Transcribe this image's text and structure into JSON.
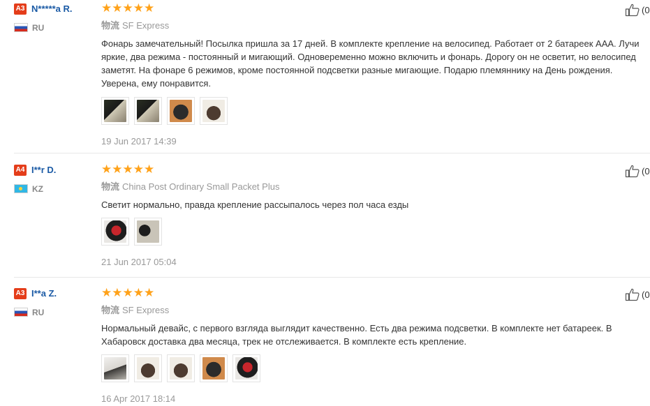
{
  "reviews": [
    {
      "level": "A3",
      "user": "N*****a R.",
      "country": "RU",
      "stars": "★★★★★",
      "logistics_label": "物流",
      "shipping": "SF Express",
      "text": "Фонарь замечательный! Посылка пришла за 17 дней. В комплекте крепление на велосипед. Работает от 2 батареек ААА. Лучи яркие, два режима - постоянный и мигающий. Одновеременно можно включить и фонарь. Дорогу он не осветит, но велосипед заметят. На фонаре 6 режимов, кроме постоянной подсветки разные мигающие. Подарю племяннику на День рождения. Уверена, ему понравится.",
      "date": "19 Jun 2017 14:39",
      "helpful": "(0",
      "photos": [
        "photo-dark-1",
        "photo-dark-2",
        "photo-bulb",
        "photo-ball"
      ]
    },
    {
      "level": "A4",
      "user": "I**r D.",
      "country": "KZ",
      "stars": "★★★★★",
      "logistics_label": "物流",
      "shipping": "China Post Ordinary Small Packet Plus",
      "text": "Светит нормально, правда крепление рассыпалось через пол часа езды",
      "date": "21 Jun 2017 05:04",
      "helpful": "(0",
      "photos": [
        "photo-red-lamp",
        "photo-pair"
      ]
    },
    {
      "level": "A3",
      "user": "I**a Z.",
      "country": "RU",
      "stars": "★★★★★",
      "logistics_label": "物流",
      "shipping": "SF Express",
      "text": "Нормальный девайс, с первого взгляда выглядит качественно. Есть два режима подсветки. В комплекте нет батареек. В Хабаровск доставка два месяца, трек не отслеживается. В комплекте есть крепление.",
      "date": "16 Apr 2017 18:14",
      "helpful": "(0",
      "photos": [
        "photo-package",
        "photo-light-1",
        "photo-light-2",
        "photo-light-3",
        "photo-red-back"
      ]
    }
  ],
  "colors": {
    "level_badge": "#e43d1a",
    "username": "#1a5aa5",
    "stars": "#ffa21a",
    "muted": "#999999"
  },
  "icons": {
    "helpful": "thumbs-up-icon"
  }
}
